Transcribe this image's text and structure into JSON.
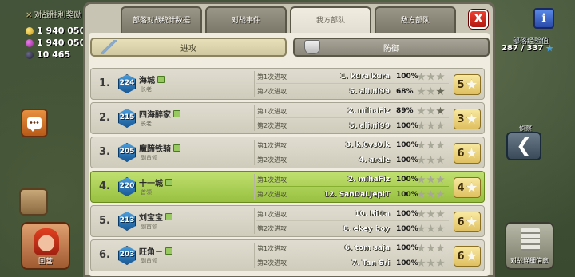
{
  "left": {
    "war_bonus_label": "对战胜利奖励",
    "resources": [
      {
        "type": "gold",
        "value": "1 940 050"
      },
      {
        "type": "elixir",
        "value": "1 940 050"
      },
      {
        "type": "dark",
        "value": "10 465"
      }
    ],
    "hero_label": "回营"
  },
  "right": {
    "exp_label": "部落经验值",
    "exp_value": "287 / 337",
    "scout_label": "侦察",
    "back_arrow": "❮",
    "details_label": "对战详细信息"
  },
  "tabs": [
    {
      "label": "部落对战统计数据",
      "active": false
    },
    {
      "label": "对战事件",
      "active": false
    },
    {
      "label": "我方部队",
      "active": true
    },
    {
      "label": "敌方部队",
      "active": false
    }
  ],
  "close_label": "X",
  "toggle": {
    "attack": "进攻",
    "defense": "防御"
  },
  "rows": [
    {
      "rank": "1.",
      "th": "224",
      "name": "海城",
      "role": "长老",
      "highlight": false,
      "attacks": [
        {
          "label": "第1次进攻",
          "target": "1. kura kura",
          "pct": "100%",
          "stars": [
            "off",
            "off",
            "off"
          ]
        },
        {
          "label": "第2次进攻",
          "target": "5. ali.ni99",
          "pct": "68%",
          "stars": [
            "off",
            "off",
            "dark"
          ]
        }
      ],
      "total": "5"
    },
    {
      "rank": "2.",
      "th": "215",
      "name": "四海醉家",
      "role": "长老",
      "highlight": false,
      "attacks": [
        {
          "label": "第1次进攻",
          "target": "2. mihaFiz",
          "pct": "89%",
          "stars": [
            "off",
            "off",
            "dark"
          ]
        },
        {
          "label": "第2次进攻",
          "target": "5. ali.ni99",
          "pct": "100%",
          "stars": [
            "off",
            "off",
            "off"
          ]
        }
      ],
      "total": "3"
    },
    {
      "rank": "3.",
      "th": "205",
      "name": "魔蹄铁骑",
      "role": "副首领",
      "highlight": false,
      "attacks": [
        {
          "label": "第1次进攻",
          "target": "3. k.0vs0.k",
          "pct": "100%",
          "stars": [
            "off",
            "off",
            "off"
          ]
        },
        {
          "label": "第2次进攻",
          "target": "4. arale",
          "pct": "100%",
          "stars": [
            "off",
            "off",
            "off"
          ]
        }
      ],
      "total": "6"
    },
    {
      "rank": "4.",
      "th": "220",
      "name": "十一城",
      "role": "首领",
      "highlight": true,
      "attacks": [
        {
          "label": "第1次进攻",
          "target": "2. mihaFiz",
          "pct": "100%",
          "stars": [
            "off",
            "off",
            "off"
          ]
        },
        {
          "label": "第2次进攻",
          "target": "12. SanDaLJepiT",
          "pct": "100%",
          "stars": [
            "off",
            "off",
            "off"
          ]
        }
      ],
      "total": "4"
    },
    {
      "rank": "5.",
      "th": "213",
      "name": "刘宝宝",
      "role": "副首领",
      "highlight": false,
      "attacks": [
        {
          "label": "第1次进攻",
          "target": "10. Ritta",
          "pct": "100%",
          "stars": [
            "off",
            "off",
            "off"
          ]
        },
        {
          "label": "第2次进攻",
          "target": "8. ekey boy",
          "pct": "100%",
          "stars": [
            "off",
            "off",
            "off"
          ]
        }
      ],
      "total": "6"
    },
    {
      "rank": "6.",
      "th": "203",
      "name": "旺角－",
      "role": "副首领",
      "highlight": false,
      "attacks": [
        {
          "label": "第1次进攻",
          "target": "6. tom saja",
          "pct": "100%",
          "stars": [
            "off",
            "off",
            "off"
          ]
        },
        {
          "label": "第2次进攻",
          "target": "7. Tan Sri",
          "pct": "100%",
          "stars": [
            "off",
            "off",
            "off"
          ]
        }
      ],
      "total": "6"
    }
  ]
}
